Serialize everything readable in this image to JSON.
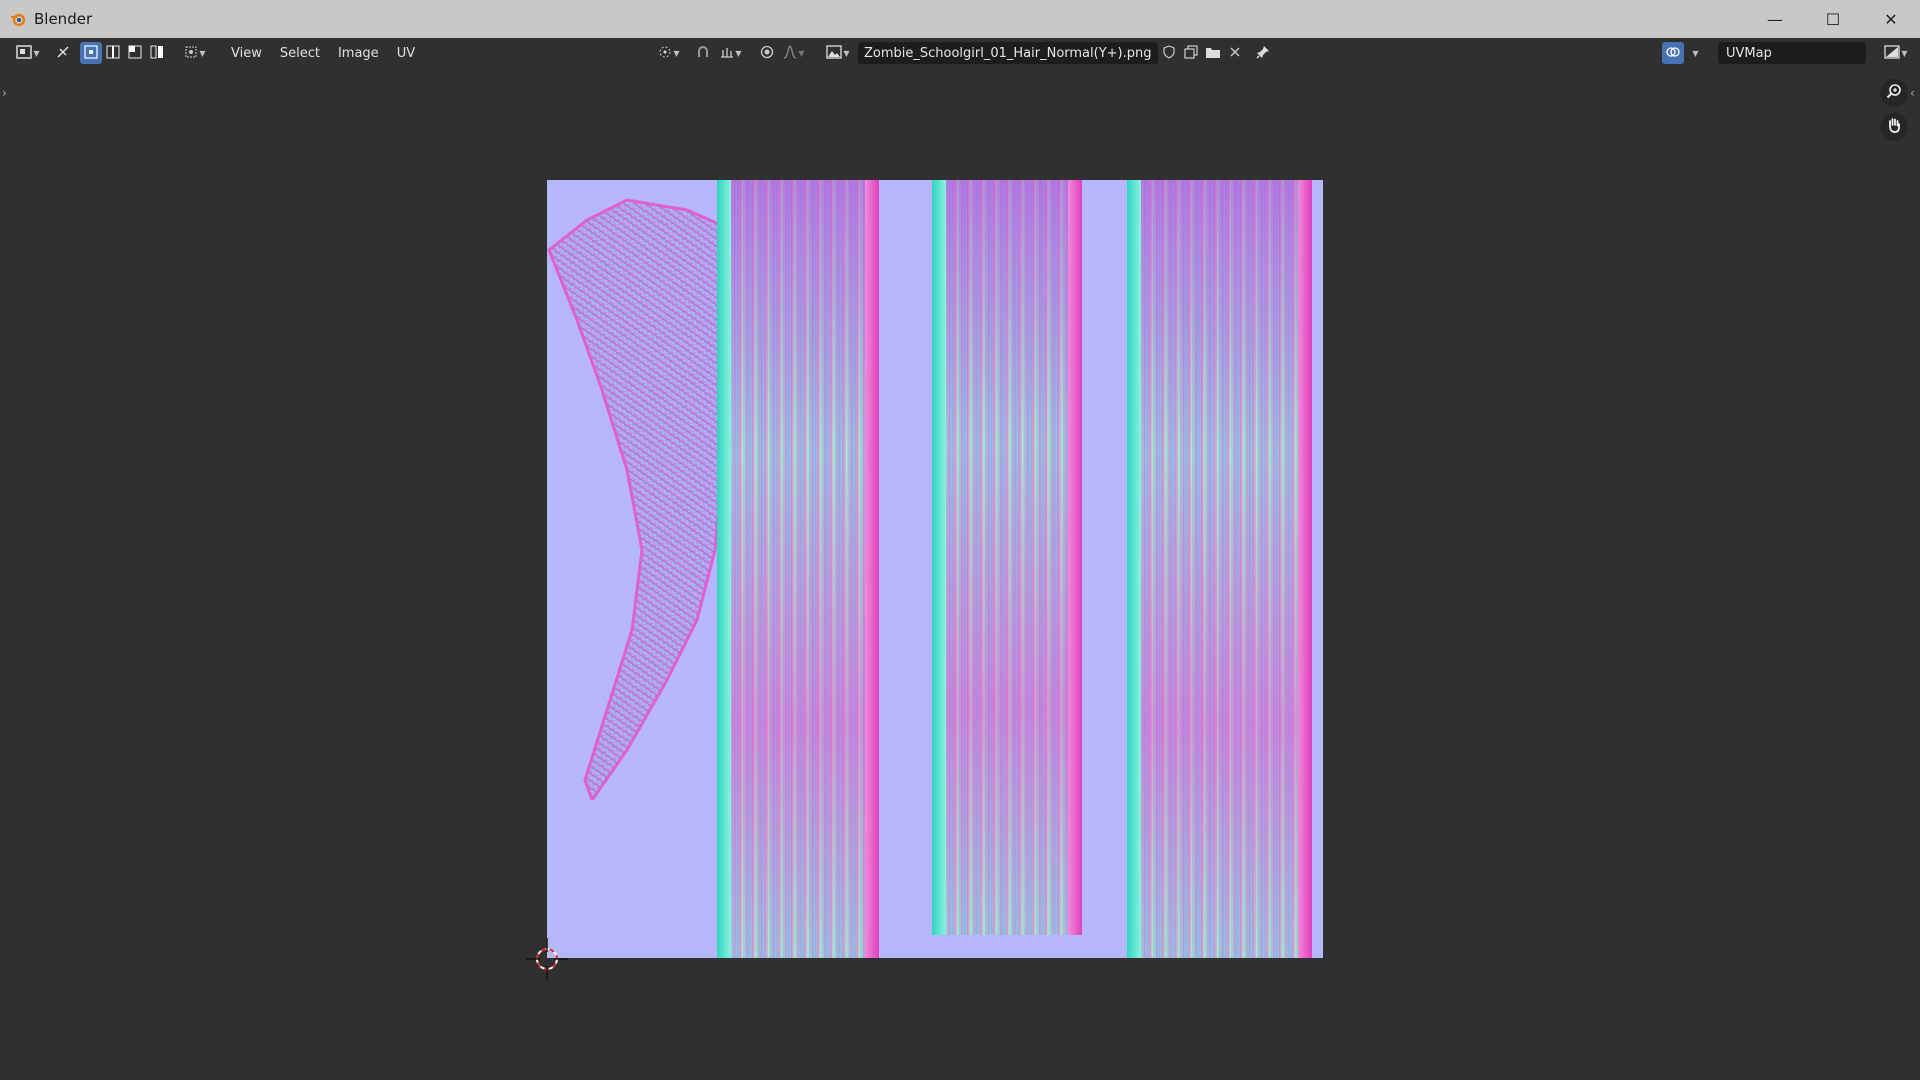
{
  "window": {
    "title": "Blender",
    "controls": {
      "minimize": "—",
      "maximize": "☐",
      "close": "✕"
    }
  },
  "toolbar": {
    "menus": [
      "View",
      "Select",
      "Image",
      "UV"
    ],
    "image_name": "Zombie_Schoolgirl_01_Hair_Normal(Y+).png",
    "uv_map": "UVMap"
  },
  "colors": {
    "accent": "#4772b3",
    "texture_background": "#b6b6fb",
    "header_bg": "#303030",
    "titlebar_bg": "#c8c8c8"
  },
  "icons": {
    "editor_type": "image-editor-icon",
    "sync": "uv-sync-icon",
    "select_modes": [
      "vertex-mode-icon",
      "edge-mode-icon",
      "face-mode-icon",
      "island-mode-icon"
    ],
    "sticky": "sticky-select-icon",
    "pivot": "pivot-point-icon",
    "snap": "snap-icon",
    "snap_target": "snap-target-icon",
    "proportional": "proportional-edit-icon",
    "falloff": "falloff-curve-icon",
    "image_browse": "image-browse-icon",
    "fake_user": "fake-user-shield-icon",
    "new_image": "new-image-icon",
    "open_image": "folder-icon",
    "unlink": "close-icon",
    "pin": "pin-icon",
    "overlays": "overlay-icon",
    "display_channels": "display-channels-icon",
    "zoom": "zoom-icon",
    "pan": "hand-icon"
  }
}
